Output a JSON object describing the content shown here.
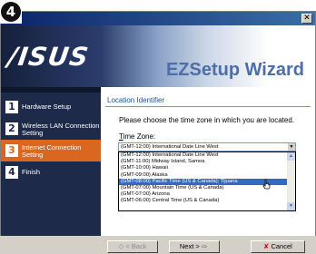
{
  "step_number": "4",
  "window": {
    "close_glyph": "✕"
  },
  "banner": {
    "logo_text": "/ISUS",
    "title": "EZSetup Wizard"
  },
  "sidebar": {
    "items": [
      {
        "num": "1",
        "label": "Hardware Setup",
        "active": false
      },
      {
        "num": "2",
        "label": "Wireless LAN Connection Setting",
        "active": false
      },
      {
        "num": "3",
        "label": "Internet Connection Setting",
        "active": true
      },
      {
        "num": "4",
        "label": "Finish",
        "active": false
      }
    ]
  },
  "content": {
    "section_title": "Location Identifier",
    "instruction": "Please choose the time zone in which you are located.",
    "tz_label_underlined": "T",
    "tz_label_rest": "ime Zone:",
    "selected_value": "(GMT-12:00) International Date Line West",
    "options": [
      "(GMT-12:00) International Date Line West",
      "(GMT-11:00) Midway Island, Samoa",
      "(GMT-10:00) Hawaii",
      "(GMT-09:00) Alaska",
      "(GMT-08:00) Pacific Time (US & Canada); Tijuana",
      "(GMT-07:00) Mountain Time (US & Canada)",
      "(GMT-07:00) Arizona",
      "(GMT-06:00) Central Time (US & Canada)"
    ],
    "highlighted_option": "(GMT-08:00) Pacific Time (US & Canada); Tijuana"
  },
  "footer": {
    "back_label": "< Back",
    "next_label": "Next >",
    "cancel_label": "Cancel",
    "back_icon": "◇",
    "next_icon": "⇨",
    "cancel_icon": "✘"
  },
  "colors": {
    "accent": "#d9671f",
    "nav_bg": "#1d2a4a",
    "title_blue": "#4d6ea6",
    "highlight": "#316ac5"
  }
}
